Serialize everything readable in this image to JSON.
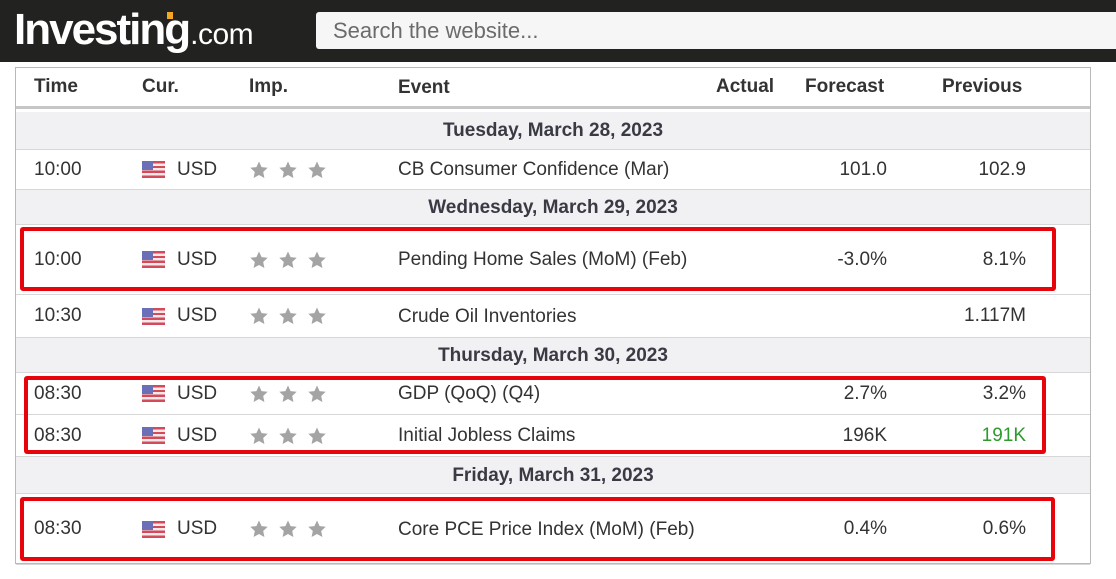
{
  "site": {
    "logo_main": "Investing",
    "logo_suffix": ".com",
    "search_placeholder": "Search the website..."
  },
  "columns": {
    "time": "Time",
    "currency": "Cur.",
    "importance": "Imp.",
    "event": "Event",
    "actual": "Actual",
    "forecast": "Forecast",
    "previous": "Previous"
  },
  "days": [
    {
      "date": "Tuesday, March 28, 2023",
      "events": [
        {
          "time": "10:00",
          "currency": "USD",
          "flag": "us-flag-icon",
          "importance_stars": 3,
          "event": "CB Consumer Confidence (Mar)",
          "actual": "",
          "forecast": "101.0",
          "previous": "102.9",
          "highlighted": false
        }
      ]
    },
    {
      "date": "Wednesday, March 29, 2023",
      "events": [
        {
          "time": "10:00",
          "currency": "USD",
          "flag": "us-flag-icon",
          "importance_stars": 3,
          "event": "Pending Home Sales (MoM) (Feb)",
          "actual": "",
          "forecast": "-3.0%",
          "previous": "8.1%",
          "highlighted": true
        },
        {
          "time": "10:30",
          "currency": "USD",
          "flag": "us-flag-icon",
          "importance_stars": 3,
          "event": "Crude Oil Inventories",
          "actual": "",
          "forecast": "",
          "previous": "1.117M",
          "highlighted": false
        }
      ]
    },
    {
      "date": "Thursday, March 30, 2023",
      "events": [
        {
          "time": "08:30",
          "currency": "USD",
          "flag": "us-flag-icon",
          "importance_stars": 3,
          "event": "GDP (QoQ) (Q4)",
          "actual": "",
          "forecast": "2.7%",
          "previous": "3.2%",
          "highlighted": true
        },
        {
          "time": "08:30",
          "currency": "USD",
          "flag": "us-flag-icon",
          "importance_stars": 3,
          "event": "Initial Jobless Claims",
          "actual": "",
          "forecast": "196K",
          "previous": "191K",
          "previous_color": "#2e9a2e",
          "highlighted": true
        }
      ]
    },
    {
      "date": "Friday, March 31, 2023",
      "events": [
        {
          "time": "08:30",
          "currency": "USD",
          "flag": "us-flag-icon",
          "importance_stars": 3,
          "event": "Core PCE Price Index (MoM) (Feb)",
          "actual": "",
          "forecast": "0.4%",
          "previous": "0.6%",
          "highlighted": true
        }
      ]
    }
  ],
  "colors": {
    "header_bg": "#222220",
    "logo_accent": "#f5a623",
    "highlight_border": "#e8040b",
    "positive": "#2e9a2e",
    "star": "#a4a4a4"
  }
}
